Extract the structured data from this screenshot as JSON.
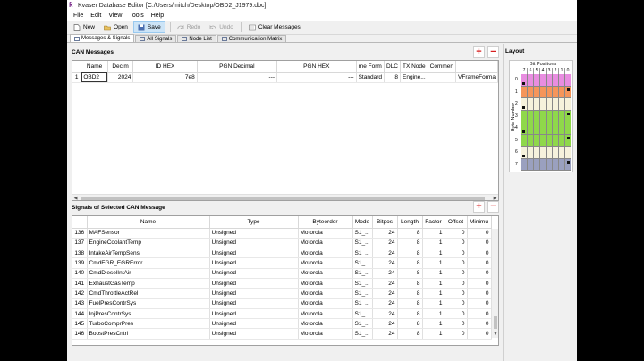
{
  "window": {
    "title": "Kvaser Database Editor [C:/Users/mitch/Desktop/OBD2_J1979.dbc]"
  },
  "menu": [
    "File",
    "Edit",
    "View",
    "Tools",
    "Help"
  ],
  "toolbar": {
    "new": "New",
    "open": "Open",
    "save": "Save",
    "redo": "Redo",
    "undo": "Undo",
    "clear": "Clear Messages"
  },
  "tabs": [
    "Messages & Signals",
    "All Signals",
    "Node List",
    "Communication Matrix"
  ],
  "can_messages": {
    "title": "CAN Messages",
    "columns": [
      "",
      "Name",
      "Decim",
      "ID HEX",
      "PGN Decimal",
      "PGN HEX",
      "me Form",
      "DLC",
      "TX Node",
      "Commen",
      ""
    ],
    "rows": [
      [
        "1",
        "OBD2",
        "2024",
        "7e8",
        "---",
        "---",
        "Standard",
        "8",
        "Engine...",
        "",
        "VFrameForma"
      ]
    ]
  },
  "signals": {
    "title": "Signals of Selected CAN Message",
    "columns": [
      "",
      "Name",
      "Type",
      "Byteorder",
      "Mode",
      "Bitpos",
      "Length",
      "Factor",
      "Offset",
      "Minimu"
    ],
    "rows": [
      [
        "136",
        "MAFSensor",
        "Unsigned",
        "Motorola",
        "S1_...",
        "24",
        "8",
        "1",
        "0",
        "0"
      ],
      [
        "137",
        "EngineCoolantTemp",
        "Unsigned",
        "Motorola",
        "S1_...",
        "24",
        "8",
        "1",
        "0",
        "0"
      ],
      [
        "138",
        "IntakeAirTempSens",
        "Unsigned",
        "Motorola",
        "S1_...",
        "24",
        "8",
        "1",
        "0",
        "0"
      ],
      [
        "139",
        "CmdEGR_EGRError",
        "Unsigned",
        "Motorola",
        "S1_...",
        "24",
        "8",
        "1",
        "0",
        "0"
      ],
      [
        "140",
        "CmdDieselIntAir",
        "Unsigned",
        "Motorola",
        "S1_...",
        "24",
        "8",
        "1",
        "0",
        "0"
      ],
      [
        "141",
        "ExhaustGasTemp",
        "Unsigned",
        "Motorola",
        "S1_...",
        "24",
        "8",
        "1",
        "0",
        "0"
      ],
      [
        "142",
        "CmdThrottleActRel",
        "Unsigned",
        "Motorola",
        "S1_...",
        "24",
        "8",
        "1",
        "0",
        "0"
      ],
      [
        "143",
        "FuelPresContrSys",
        "Unsigned",
        "Motorola",
        "S1_...",
        "24",
        "8",
        "1",
        "0",
        "0"
      ],
      [
        "144",
        "InjPresContrSys",
        "Unsigned",
        "Motorola",
        "S1_...",
        "24",
        "8",
        "1",
        "0",
        "0"
      ],
      [
        "145",
        "TurboComprPres",
        "Unsigned",
        "Motorola",
        "S1_...",
        "24",
        "8",
        "1",
        "0",
        "0"
      ],
      [
        "146",
        "BoostPresCntrl",
        "Unsigned",
        "Motorola",
        "S1_...",
        "24",
        "8",
        "1",
        "0",
        "0"
      ]
    ]
  },
  "layout": {
    "title": "Layout",
    "bit_positions_label": "Bit Positions",
    "bits": [
      "7",
      "6",
      "5",
      "4",
      "3",
      "2",
      "1",
      "0"
    ],
    "byte_number_label": "Byte Number",
    "bytes": [
      "0",
      "1",
      "2",
      "3",
      "4",
      "5",
      "6",
      "7"
    ],
    "byte_colors": [
      "#e88de0",
      "#f5955a",
      "#f6f2dc",
      "#8fd84a",
      "#8fd84a",
      "#8fd84a",
      "#f6f2dc",
      "#9aa0bf"
    ]
  },
  "colors": {
    "accent": "#d61a1a"
  }
}
